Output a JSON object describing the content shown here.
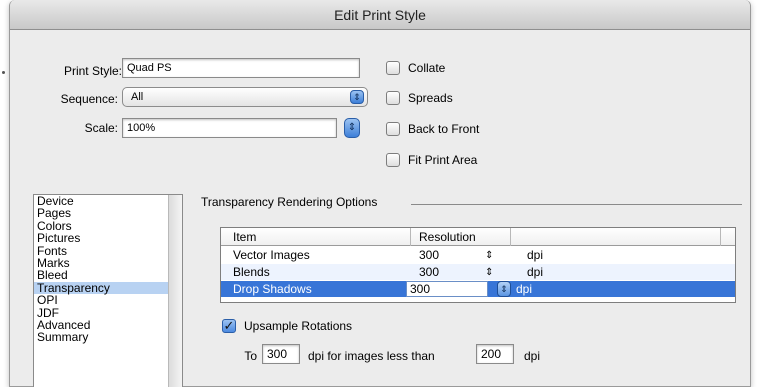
{
  "window": {
    "title": "Edit Print Style"
  },
  "form": {
    "print_style_label": "Print Style:",
    "print_style_value": "Quad PS",
    "sequence_label": "Sequence:",
    "sequence_value": "All",
    "scale_label": "Scale:",
    "scale_value": "100%"
  },
  "options": {
    "collate": {
      "label": "Collate",
      "checked": false
    },
    "spreads": {
      "label": "Spreads",
      "checked": false
    },
    "back_to_front": {
      "label": "Back to Front",
      "checked": false
    },
    "fit_print_area": {
      "label": "Fit Print Area",
      "checked": false
    }
  },
  "sidebar": {
    "items": [
      "Device",
      "Pages",
      "Colors",
      "Pictures",
      "Fonts",
      "Marks",
      "Bleed",
      "Transparency",
      "OPI",
      "JDF",
      "Advanced",
      "Summary"
    ],
    "selected": "Transparency"
  },
  "transparency": {
    "group_title": "Transparency Rendering Options",
    "columns": [
      "Item",
      "Resolution",
      ""
    ],
    "rows": [
      {
        "item": "Vector Images",
        "resolution": "300",
        "unit": "dpi"
      },
      {
        "item": "Blends",
        "resolution": "300",
        "unit": "dpi"
      },
      {
        "item": "Drop Shadows",
        "resolution": "300",
        "unit": "dpi"
      }
    ],
    "selected_row": "Drop Shadows",
    "upsample_label": "Upsample Rotations",
    "upsample_checked": true,
    "to_label": "To",
    "to_value": "300",
    "dpi_less_label": "dpi for images less than",
    "less_than_value": "200",
    "dpi_label": "dpi"
  },
  "colors": {
    "selection_blue": "#3875d7",
    "list_selection": "#b8d2f2",
    "accent_stepper": "#3d7fd8"
  }
}
